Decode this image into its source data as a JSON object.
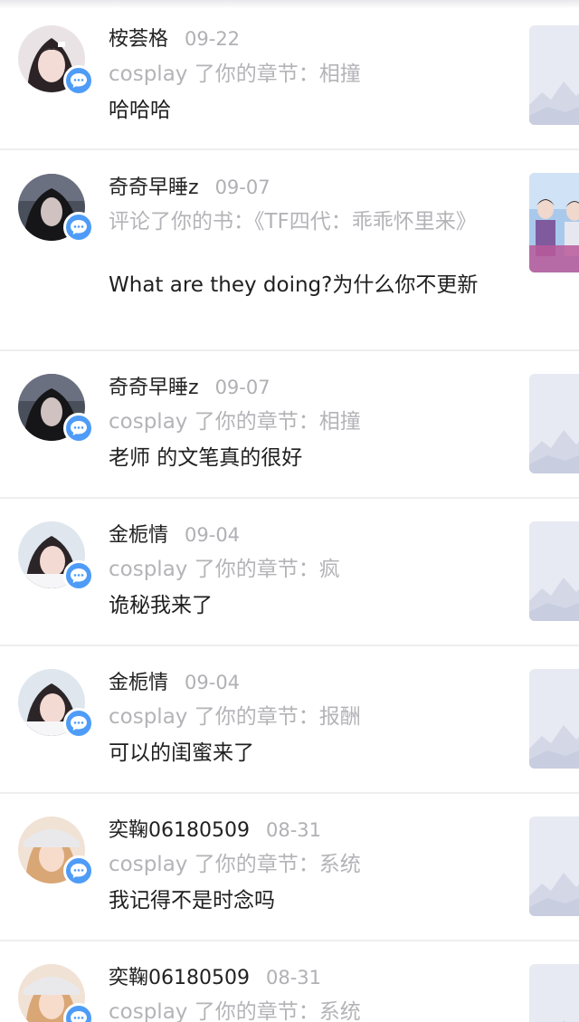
{
  "notifications": [
    {
      "user": "桉荟格",
      "date": "09-22",
      "action": "cosplay 了你的章节：相撞",
      "content": "哈哈哈",
      "avatar_icon": "avatar-girl-light",
      "thumb": "placeholder"
    },
    {
      "user": "奇奇早睡z",
      "date": "09-07",
      "action": "评论了你的书：《TF四代：乖乖怀里来》",
      "content": "What are they doing?为什么你不更新",
      "avatar_icon": "avatar-dark",
      "thumb": "book-cover"
    },
    {
      "user": "奇奇早睡z",
      "date": "09-07",
      "action": "cosplay 了你的章节：相撞",
      "content": "老师 的文笔真的很好",
      "avatar_icon": "avatar-dark",
      "thumb": "placeholder"
    },
    {
      "user": "金栀情",
      "date": "09-04",
      "action": "cosplay 了你的章节：疯",
      "content": "诡秘我来了",
      "avatar_icon": "avatar-girl-light",
      "thumb": "placeholder"
    },
    {
      "user": "金栀情",
      "date": "09-04",
      "action": "cosplay 了你的章节：报酬",
      "content": "可以的闺蜜来了",
      "avatar_icon": "avatar-girl-light",
      "thumb": "placeholder"
    },
    {
      "user": "奕鞠06180509",
      "date": "08-31",
      "action": "cosplay 了你的章节：系统",
      "content": "我记得不是时念吗",
      "avatar_icon": "avatar-warm",
      "thumb": "placeholder"
    },
    {
      "user": "奕鞠06180509",
      "date": "08-31",
      "action": "cosplay 了你的章节：系统",
      "content": "",
      "avatar_icon": "avatar-warm",
      "thumb": "placeholder"
    }
  ],
  "colors": {
    "badge": "#4e9cf7",
    "separator": "#eeeeef",
    "secondary_text": "#b4b4b8",
    "thumb_bg": "#e8eaf3"
  }
}
